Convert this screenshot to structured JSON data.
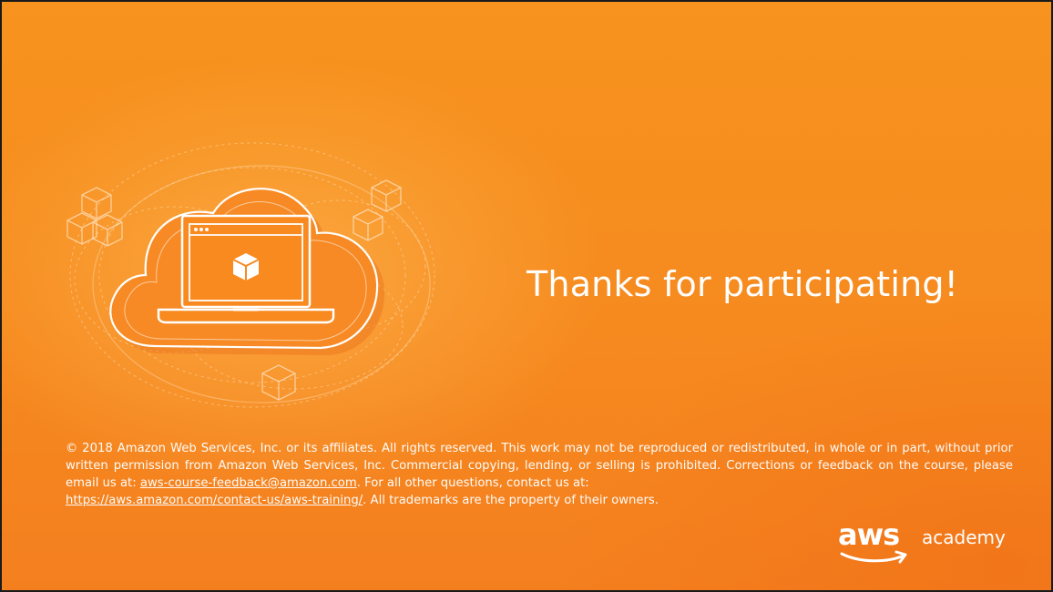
{
  "slide": {
    "title": "Thanks for participating!",
    "legal": {
      "text_1": "© 2018 Amazon Web Services, Inc. or its affiliates. All rights reserved. This work may not be reproduced or redistributed, in whole or in part, without prior written permission from Amazon Web Services, Inc. Commercial copying, lending, or selling is prohibited. Corrections or feedback on the course, please email us at: ",
      "email_link": "aws-course-feedback@amazon.com",
      "text_2": ". For all other questions, contact us at: ",
      "url_link": "https://aws.amazon.com/contact-us/aws-training/",
      "text_3": ".  All trademarks are the property of their owners."
    },
    "brand": {
      "logo_text": "aws",
      "suffix": "academy"
    },
    "illustration": {
      "icon": "cloud-laptop-icon"
    },
    "colors": {
      "background": "#f68a1f",
      "text": "#ffffff"
    }
  }
}
